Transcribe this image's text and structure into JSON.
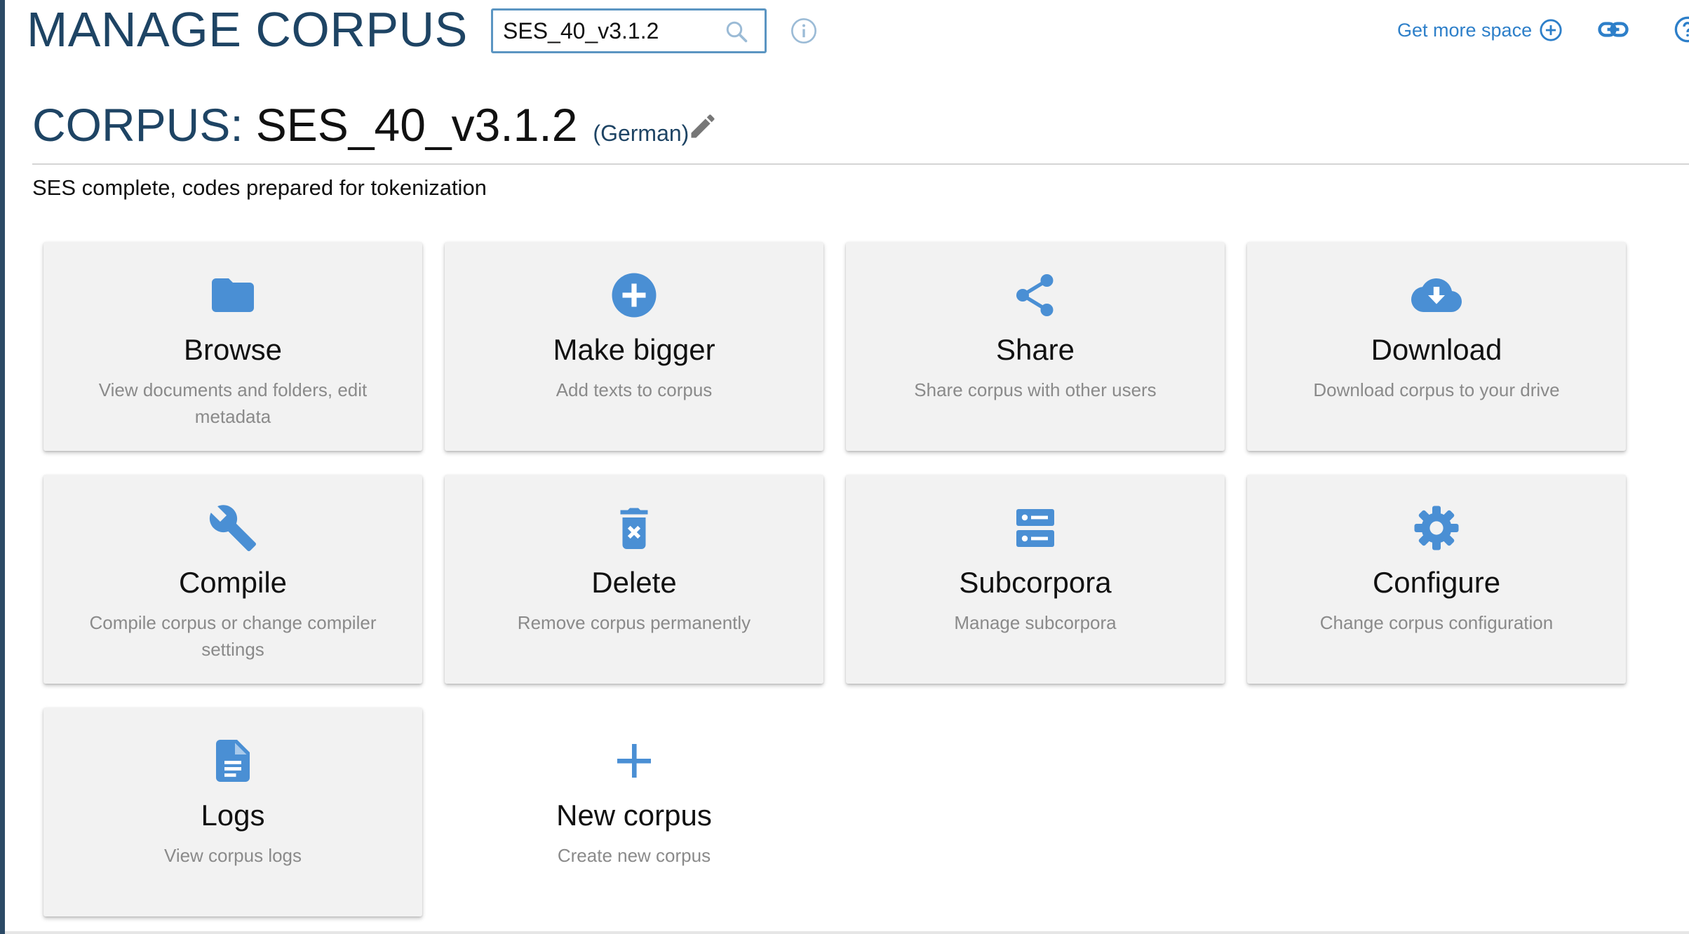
{
  "header": {
    "app_title": "MANAGE CORPUS",
    "search": {
      "value": "SES_40_v3.1.2",
      "icon": "search-icon"
    },
    "get_more_space": "Get more space"
  },
  "corpus": {
    "prefix": "CORPUS:",
    "name": "SES_40_v3.1.2",
    "language": "(German)",
    "description": "SES complete, codes prepared for tokenization"
  },
  "colors": {
    "accent": "#4a8fd4",
    "title": "#1e4464",
    "link": "#2d7fc9",
    "card_bg": "#f2f2f2"
  },
  "cards": [
    {
      "title": "Browse",
      "desc": "View documents and folders, edit metadata",
      "icon": "folder-icon"
    },
    {
      "title": "Make bigger",
      "desc": "Add texts to corpus",
      "icon": "plus-circle-icon"
    },
    {
      "title": "Share",
      "desc": "Share corpus with other users",
      "icon": "share-icon"
    },
    {
      "title": "Download",
      "desc": "Download corpus to your drive",
      "icon": "cloud-download-icon"
    },
    {
      "title": "Compile",
      "desc": "Compile corpus or change compiler settings",
      "icon": "wrench-icon"
    },
    {
      "title": "Delete",
      "desc": "Remove corpus permanently",
      "icon": "trash-icon"
    },
    {
      "title": "Subcorpora",
      "desc": "Manage subcorpora",
      "icon": "storage-icon"
    },
    {
      "title": "Configure",
      "desc": "Change corpus configuration",
      "icon": "gear-icon"
    },
    {
      "title": "Logs",
      "desc": "View corpus logs",
      "icon": "document-icon"
    },
    {
      "title": "New corpus",
      "desc": "Create new corpus",
      "icon": "plus-icon"
    }
  ]
}
